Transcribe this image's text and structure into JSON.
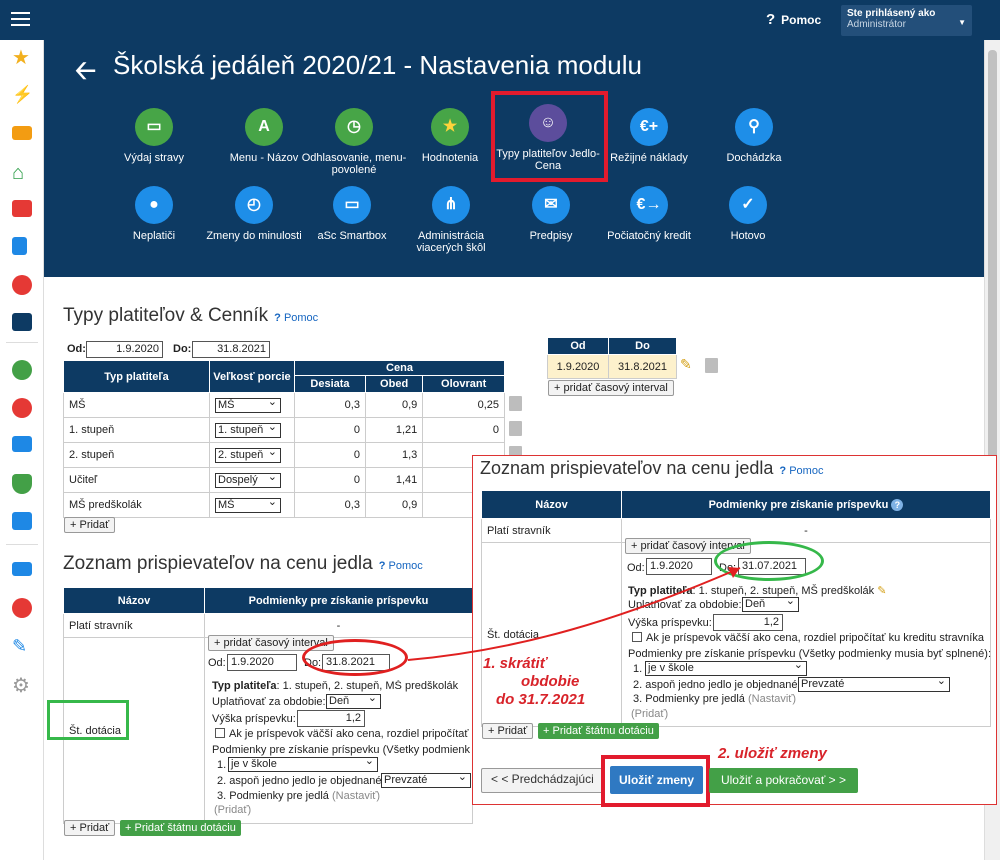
{
  "header": {
    "help": "Pomoc",
    "user_l1": "Ste prihlásený ako",
    "user_l2": "Administrátor",
    "title": "Školská jedáleň 2020/21 - Nastavenia modulu"
  },
  "modules": [
    {
      "label": "Výdaj stravy",
      "icon": "open-sign-icon",
      "color": "#47a547"
    },
    {
      "label": "Menu - Názov",
      "icon": "abc-icon",
      "color": "#47a547"
    },
    {
      "label": "Odhlasovanie, menu-povolené",
      "icon": "clock-icon",
      "color": "#47a547"
    },
    {
      "label": "Hodnotenia",
      "icon": "star-icon",
      "color": "#47a547"
    },
    {
      "label": "Typy platiteľov Jedlo-Cena",
      "icon": "payer-icon",
      "color": "#5c4d9c"
    },
    {
      "label": "Režijné náklady",
      "icon": "euro-plus-icon",
      "color": "#1e8ee8"
    },
    {
      "label": "Dochádzka",
      "icon": "walk-icon",
      "color": "#1e8ee8"
    },
    {
      "label": "Neplatiči",
      "icon": "pig-icon",
      "color": "#1e8ee8"
    },
    {
      "label": "Zmeny do minulosti",
      "icon": "alarm-icon",
      "color": "#1e8ee8"
    },
    {
      "label": "aSc Smartbox",
      "icon": "monitor-icon",
      "color": "#1e8ee8"
    },
    {
      "label": "Administrácia viacerých škôl",
      "icon": "org-icon",
      "color": "#1e8ee8"
    },
    {
      "label": "Predpisy",
      "icon": "handshake-icon",
      "color": "#1e8ee8"
    },
    {
      "label": "Počiatočný kredit",
      "icon": "euro-arrow-icon",
      "color": "#1e8ee8"
    },
    {
      "label": "Hotovo",
      "icon": "check-icon",
      "color": "#1e8ee8"
    }
  ],
  "payers": {
    "title": "Typy platiteľov & Cenník",
    "help": "Pomoc",
    "od_label": "Od:",
    "od": "1.9.2020",
    "do_label": "Do:",
    "do": "31.8.2021",
    "col_type": "Typ platiteľa",
    "col_size": "Veľkosť porcie",
    "col_price": "Cena",
    "col_desiata": "Desiata",
    "col_obed": "Obed",
    "col_olovrant": "Olovrant",
    "rows": [
      {
        "type": "MŠ",
        "size": "MŠ",
        "desiata": "0,3",
        "obed": "0,9",
        "olovrant": "0,25"
      },
      {
        "type": "1. stupeň",
        "size": "1. stupeň",
        "desiata": "0",
        "obed": "1,21",
        "olovrant": "0"
      },
      {
        "type": "2. stupeň",
        "size": "2. stupeň",
        "desiata": "0",
        "obed": "1,3",
        "olovrant": ""
      },
      {
        "type": "Učiteľ",
        "size": "Dospelý",
        "desiata": "0",
        "obed": "1,41",
        "olovrant": ""
      },
      {
        "type": "MŠ predškolák",
        "size": "MŠ",
        "desiata": "0,3",
        "obed": "0,9",
        "olovrant": ""
      }
    ],
    "add": "+ Pridať",
    "int_od": "Od",
    "int_do": "Do",
    "int_from": "1.9.2020",
    "int_to": "31.8.2021",
    "add_interval": "+ pridať časový interval"
  },
  "contrib": {
    "title": "Zoznam prispievateľov na cenu jedla",
    "help": "Pomoc",
    "col_name": "Názov",
    "col_cond": "Podmienky pre získanie príspevku",
    "row1": "Platí stravník",
    "row1_val": "-",
    "row2": "Št. dotácia",
    "add_interval": "+ pridať časový interval",
    "od": "Od:",
    "od_val": "1.9.2020",
    "do": "Do:",
    "do_val": "31.8.2021",
    "do_val_new": "31.07.2021",
    "typ_label": "Typ platiteľa",
    "typ_val": ": 1. stupeň, 2. stupeň, MŠ predškolák",
    "uplat": "Uplatňovať za obdobie:",
    "uplat_val": "Deň",
    "vyska": "Výška príspevku:",
    "vyska_val": "1,2",
    "chk": "Ak je príspevok väčší ako cena, rozdiel pripočítať ku kreditu stravníka",
    "podm_head": "Podmienky pre získanie príspevku (Všetky podmienky musia byť splnené):",
    "p1": "1.",
    "p1_val": "je v škole",
    "p2": "2. aspoň jedno jedlo je objednané",
    "p2_val": "Prevzaté",
    "p3": "3. Podmienky pre jedlá",
    "p3_link": "(Nastaviť)",
    "pridat_link": "(Pridať)",
    "add": "+ Pridať",
    "add_state": "+ Pridať štátnu dotáciu"
  },
  "footer": {
    "prev": "< < Predchádzajúci",
    "save": "Uložiť zmeny",
    "save_next": "Uložiť a pokračovať > >"
  },
  "annotations": {
    "a1": "1.   skrátiť",
    "a1b": "obdobie",
    "a1c": "do 31.7.2021",
    "a2": "2. uložiť zmeny"
  }
}
